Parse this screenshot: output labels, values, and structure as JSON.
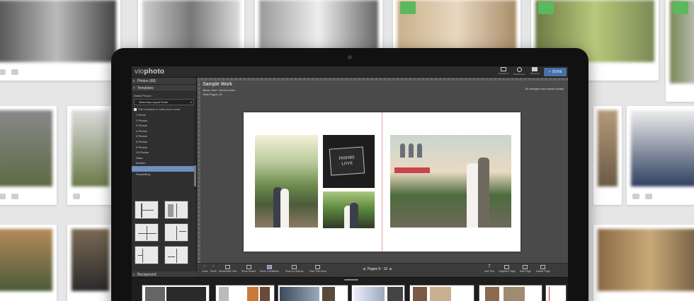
{
  "app": {
    "logo_light": "vio",
    "logo_bold": "photo",
    "header_tools": [
      {
        "label": "Full-screen",
        "icon": "fullscreen-icon"
      },
      {
        "label": "Preferences",
        "icon": "gear-icon"
      },
      {
        "label": "Slideshow",
        "icon": "play-icon"
      }
    ],
    "done_label": "✓ DONE"
  },
  "sidebar": {
    "photos_header": "Photos (68)",
    "templates_header": "Templates",
    "select_preset_label": "Select Preset:",
    "preset_value": "Select Auto Layout Preset",
    "filter_label": "Filter templates to match photo counts",
    "template_items": [
      "1 Photo",
      "2 Photos",
      "3 Photos",
      "4 Photos",
      "5 Photos",
      "6 Photos",
      "8 Photos",
      "10 Photos",
      "Stars",
      "Modern",
      "",
      "Storytelling"
    ],
    "selected_index": 10,
    "background_header": "Background"
  },
  "workspace": {
    "project_title": "Sample Work",
    "album_size": "Album Size: 10x10 inches",
    "total_pages": "Total Pages: 20",
    "saved_message": "All changes were saved locally",
    "inspire_line1": "INSPIRE",
    "inspire_line2": "LOVE",
    "pages_label": "Pages 9 - 10"
  },
  "bottom_tools": {
    "left": [
      "Undo",
      "Redo",
      "Show/Hide Grid",
      "Show Rulers",
      "Show Guidelines",
      "Snap to Objects",
      "Hide Trim Area"
    ],
    "right": [
      "Add Text",
      "Organize Page",
      "Add Page",
      "Delete Page"
    ]
  },
  "colors": {
    "accent": "#6f8fbf",
    "done_button": "#4a6fa5",
    "check_green": "#5cb85c",
    "page_divider": "#e3a3a3"
  }
}
